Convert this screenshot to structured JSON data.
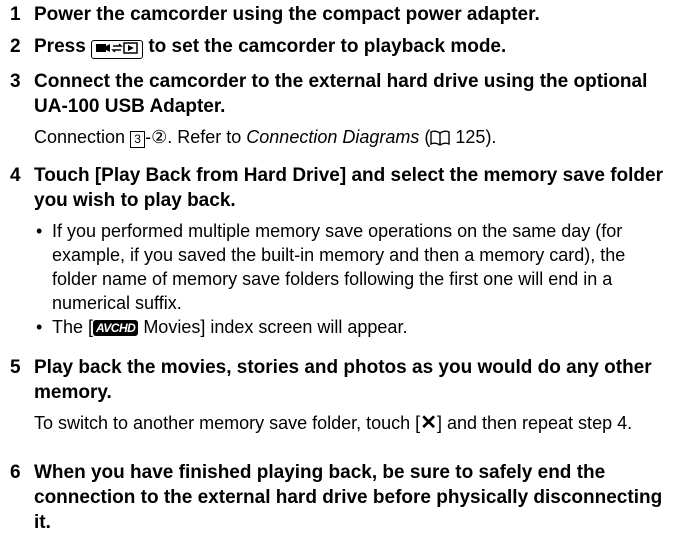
{
  "steps": [
    {
      "num": "1",
      "title": "Power the camcorder using the compact power adapter."
    },
    {
      "num": "2",
      "title_pre": "Press",
      "title_post": "to set the camcorder to playback mode."
    },
    {
      "num": "3",
      "title": "Connect the camcorder to the external hard drive using the optional UA-100 USB Adapter.",
      "body_pre": "Connection",
      "conn_num": "3",
      "conn_sub": "-②. Refer to",
      "conn_ref": "Connection Diagrams",
      "page_ref": "125",
      "body_end": ")."
    },
    {
      "num": "4",
      "title": "Touch [Play Back from Hard Drive] and select the memory save folder you wish to play back.",
      "bullets": [
        "If you performed multiple memory save operations on the same day (for example, if you saved the built-in memory and then a memory card), the folder name of memory save folders following the first one will end in a numerical suffix."
      ],
      "bullet2_pre": "The [",
      "avchd": "AVCHD",
      "bullet2_post": " Movies] index screen will appear."
    },
    {
      "num": "5",
      "title": "Play back the movies, stories and photos as you would do any other memory.",
      "body_pre": "To switch to another memory save folder, touch [",
      "x_label": "✕",
      "body_post": "] and then repeat step 4."
    },
    {
      "num": "6",
      "title": "When you have finished playing back, be sure to safely end the connection to the external hard drive before physically disconnecting it."
    }
  ]
}
